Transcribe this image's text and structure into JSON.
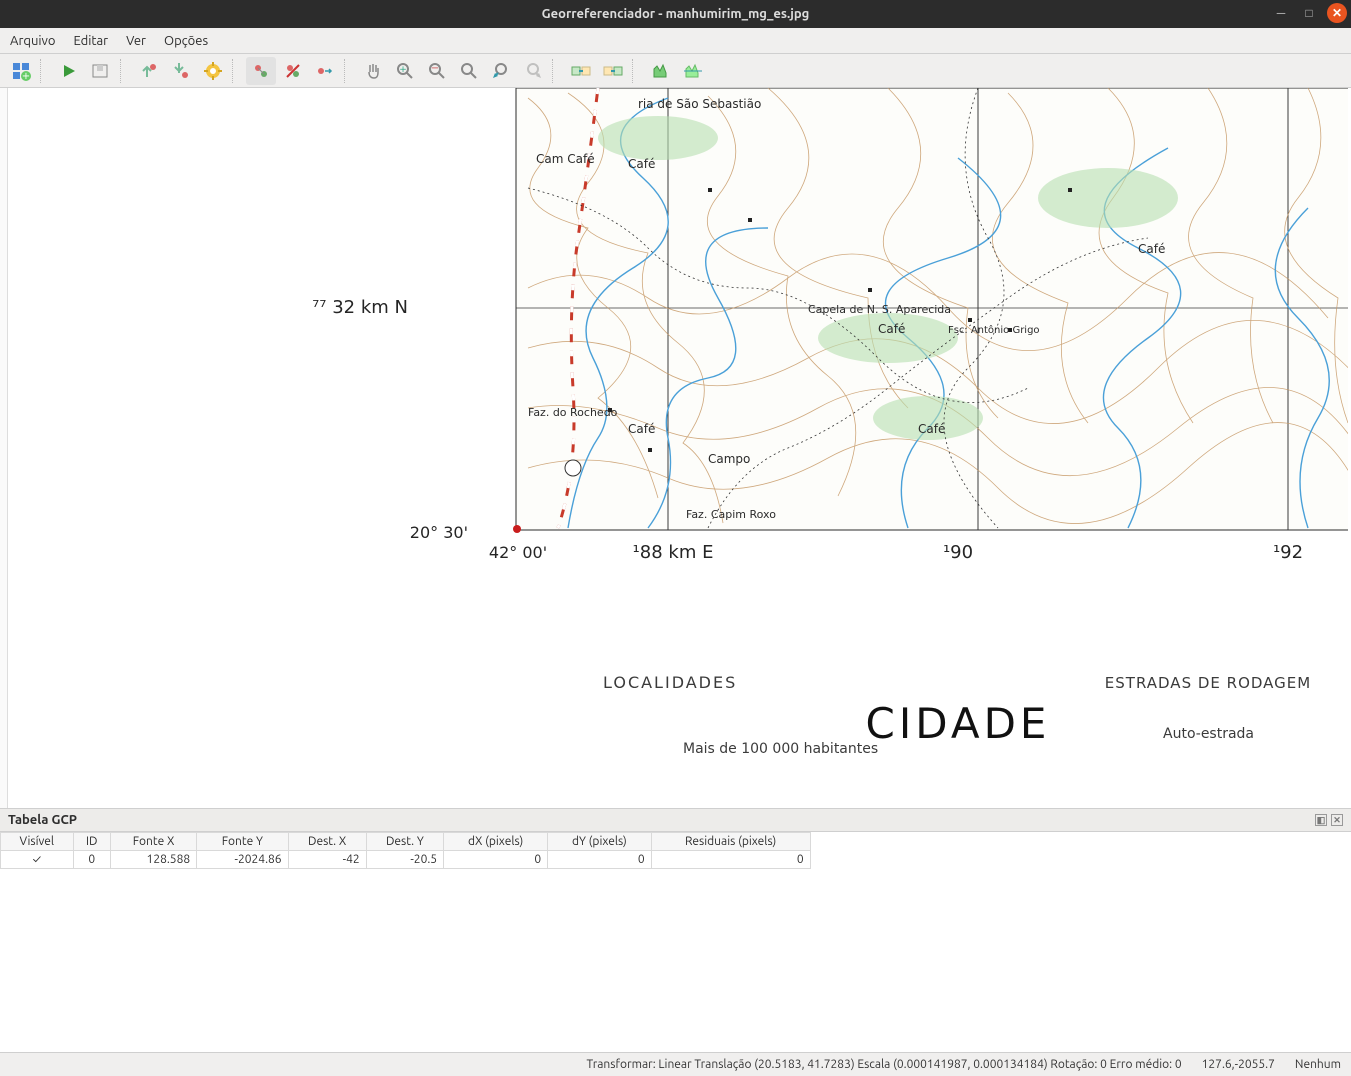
{
  "window": {
    "title": "Georreferenciador - manhumirim_mg_es.jpg"
  },
  "menubar": {
    "file": "Arquivo",
    "edit": "Editar",
    "view": "Ver",
    "options": "Opções"
  },
  "gcp": {
    "panel_title": "Tabela GCP",
    "headers": {
      "visible": "Visível",
      "id": "ID",
      "srcx": "Fonte X",
      "srcy": "Fonte Y",
      "dstx": "Dest. X",
      "dsty": "Dest. Y",
      "dx": "dX (pixels)",
      "dy": "dY (pixels)",
      "res": "Residuais (pixels)"
    },
    "row": {
      "visible": "✓",
      "id": "0",
      "srcx": "128.588",
      "srcy": "-2024.86",
      "dstx": "-42",
      "dsty": "-20.5",
      "dx": "0",
      "dy": "0",
      "res": "0"
    }
  },
  "status": {
    "transform": "Transformar: Linear Translação (20.5183, 41.7283) Escala (0.000141987, 0.000134184) Rotação: 0 Erro médio: 0",
    "coords": "127.6,-2055.7",
    "proj": "Nenhum"
  },
  "map": {
    "lat_label": "⁷⁷ 32 km N",
    "corner_lat": "20° 30'",
    "corner_lon": "42° 00'",
    "x188": "¹88 km E",
    "x190": "¹90",
    "x192": "¹92",
    "legend_loc": "LOCALIDADES",
    "legend_pop": "Mais de 100 000 habitantes",
    "legend_city": "CIDADE",
    "legend_roads": "ESTRADAS DE RODAGEM",
    "legend_auto": "Auto-estrada",
    "labels": {
      "cafe1": "Cam Café",
      "cafe2": "Café",
      "cafe3": "Café",
      "cafe4": "Café",
      "cafe5": "Café",
      "cafe6": "Café",
      "chapel": "Capela de N. S. Aparecida",
      "fsc": "Fsc. Antônio Grigo",
      "faz": "Faz. do Rochedo",
      "campo": "Campo",
      "capim": "Faz. Capim Roxo",
      "sebastiao": "ria de São Sebastião"
    }
  }
}
